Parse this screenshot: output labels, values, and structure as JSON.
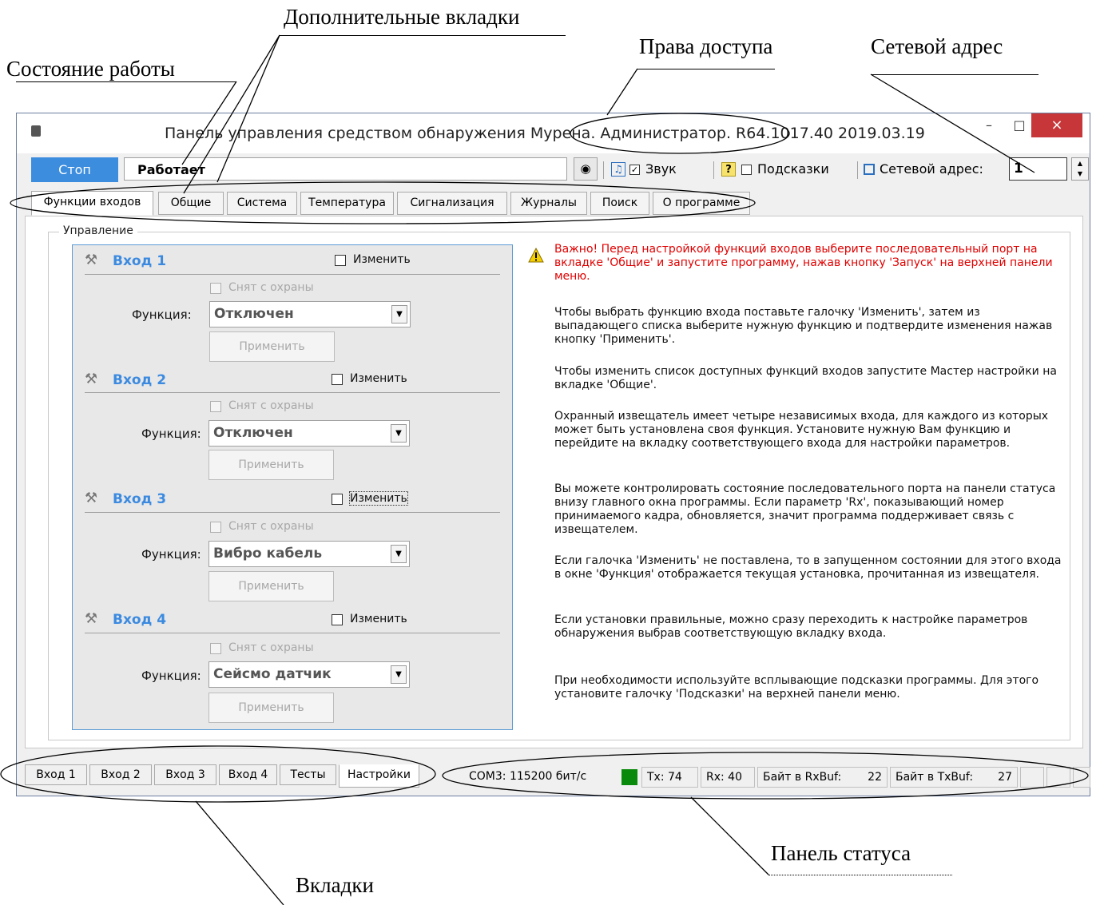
{
  "annotations": {
    "work_state": "Состояние работы",
    "extra_tabs": "Дополнительные вкладки",
    "access_rights": "Права доступа",
    "network_address": "Сетевой адрес",
    "status_panel": "Панель статуса",
    "tabs": "Вкладки"
  },
  "window": {
    "title": "Панель управления средством обнаружения Мурена. Администратор. R64.1017.40 2019.03.19",
    "minimize": "–",
    "maximize": "□",
    "close": "×"
  },
  "toolbar": {
    "stop_label": "Стоп",
    "status_value": "Работает",
    "sound_label": "Звук",
    "sound_checked": true,
    "hints_label": "Подсказки",
    "hints_checked": false,
    "net_address_label": "Сетевой адрес:",
    "net_address_value": "1"
  },
  "top_tabs": [
    "Функции входов",
    "Общие",
    "Система",
    "Температура",
    "Сигнализация",
    "Журналы",
    "Поиск",
    "О программе"
  ],
  "group_title": "Управление",
  "inputs": [
    {
      "title": "Вход 1",
      "change_label": "Изменить",
      "disarmed_label": "Снят с охраны",
      "function_label": "Функция:",
      "function_value": "Отключен",
      "apply_label": "Применить"
    },
    {
      "title": "Вход 2",
      "change_label": "Изменить",
      "disarmed_label": "Снят с охраны",
      "function_label": "Функция:",
      "function_value": "Отключен",
      "apply_label": "Применить"
    },
    {
      "title": "Вход 3",
      "change_label": "Изменить",
      "disarmed_label": "Снят с охраны",
      "function_label": "Функция:",
      "function_value": "Вибро кабель",
      "apply_label": "Применить"
    },
    {
      "title": "Вход 4",
      "change_label": "Изменить",
      "disarmed_label": "Снят с охраны",
      "function_label": "Функция:",
      "function_value": "Сейсмо датчик",
      "apply_label": "Применить"
    }
  ],
  "help": {
    "warning": "Важно! Перед настройкой функций входов выберите последовательный порт на вкладке 'Общие' и запустите программу, нажав кнопку 'Запуск' на верхней панели меню.",
    "p1": "Чтобы выбрать функцию входа поставьте галочку 'Изменить', затем из выпадающего списка выберите нужную функцию и подтвердите изменения нажав кнопку 'Применить'.",
    "p2": "Чтобы изменить список доступных функций входов запустите Мастер настройки на вкладке 'Общие'.",
    "p3": "Охранный извещатель имеет четыре независимых входа, для каждого из которых может быть установлена своя функция. Установите нужную Вам функцию и перейдите на вкладку соответствующего входа для настройки параметров.",
    "p4": "Вы можете контролировать состояние последовательного порта на панели статуса внизу главного окна программы. Если параметр 'Rx', показывающий номер принимаемого кадра, обновляется, значит программа поддерживает связь с извещателем.",
    "p5": "Если галочка 'Изменить' не поставлена, то в запущенном состоянии для этого входа в окне 'Функция' отображается текущая установка, прочитанная из извещателя.",
    "p6": "Если установки правильные, можно сразу переходить к настройке параметров обнаружения выбрав соответствующую вкладку входа.",
    "p7": "При необходимости используйте всплывающие подсказки программы. Для этого установите галочку 'Подсказки' на верхней панели меню."
  },
  "bottom_tabs": [
    "Вход 1",
    "Вход 2",
    "Вход 3",
    "Вход 4",
    "Тесты",
    "Настройки"
  ],
  "status": {
    "port": "COM3: 115200 бит/с",
    "led_color": "#0a8a0a",
    "tx": "Tx: 74",
    "rx": "Rx: 40",
    "rxbuf_label": "Байт в RxBuf:",
    "rxbuf_value": "22",
    "txbuf_label": "Байт в TxBuf:",
    "txbuf_value": "27"
  },
  "colors": {
    "accent": "#3c8dde",
    "close": "#c7373a",
    "input_title": "#3b8ae0",
    "warning": "#e00000"
  }
}
